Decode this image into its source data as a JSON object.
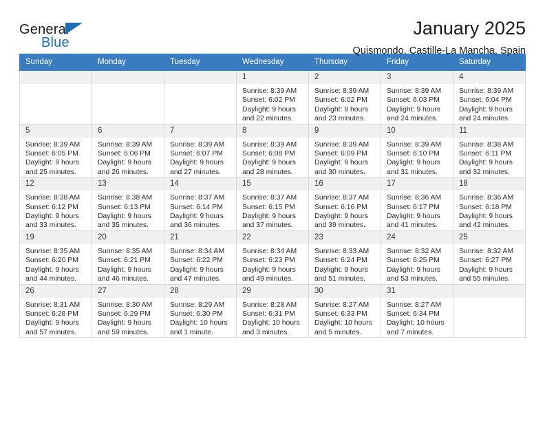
{
  "brand": {
    "word_general": "General",
    "word_blue": "Blue",
    "flag_icon": "brand-flag-icon"
  },
  "header": {
    "title": "January 2025",
    "subtitle": "Quismondo, Castille-La Mancha, Spain"
  },
  "theme": {
    "header_bg": "#3a7cc0",
    "header_text": "#ffffff",
    "daynum_bg": "#f0f0f0",
    "grid_border": "#d9d9d9",
    "brand_blue": "#1d6fb8"
  },
  "calendar": {
    "weekday_headers": [
      "Sunday",
      "Monday",
      "Tuesday",
      "Wednesday",
      "Thursday",
      "Friday",
      "Saturday"
    ],
    "weeks": [
      [
        {
          "day": "",
          "lines": []
        },
        {
          "day": "",
          "lines": []
        },
        {
          "day": "",
          "lines": []
        },
        {
          "day": "1",
          "lines": [
            "Sunrise: 8:39 AM",
            "Sunset: 6:02 PM",
            "Daylight: 9 hours",
            "and 22 minutes."
          ]
        },
        {
          "day": "2",
          "lines": [
            "Sunrise: 8:39 AM",
            "Sunset: 6:02 PM",
            "Daylight: 9 hours",
            "and 23 minutes."
          ]
        },
        {
          "day": "3",
          "lines": [
            "Sunrise: 8:39 AM",
            "Sunset: 6:03 PM",
            "Daylight: 9 hours",
            "and 24 minutes."
          ]
        },
        {
          "day": "4",
          "lines": [
            "Sunrise: 8:39 AM",
            "Sunset: 6:04 PM",
            "Daylight: 9 hours",
            "and 24 minutes."
          ]
        }
      ],
      [
        {
          "day": "5",
          "lines": [
            "Sunrise: 8:39 AM",
            "Sunset: 6:05 PM",
            "Daylight: 9 hours",
            "and 25 minutes."
          ]
        },
        {
          "day": "6",
          "lines": [
            "Sunrise: 8:39 AM",
            "Sunset: 6:06 PM",
            "Daylight: 9 hours",
            "and 26 minutes."
          ]
        },
        {
          "day": "7",
          "lines": [
            "Sunrise: 8:39 AM",
            "Sunset: 6:07 PM",
            "Daylight: 9 hours",
            "and 27 minutes."
          ]
        },
        {
          "day": "8",
          "lines": [
            "Sunrise: 8:39 AM",
            "Sunset: 6:08 PM",
            "Daylight: 9 hours",
            "and 28 minutes."
          ]
        },
        {
          "day": "9",
          "lines": [
            "Sunrise: 8:39 AM",
            "Sunset: 6:09 PM",
            "Daylight: 9 hours",
            "and 30 minutes."
          ]
        },
        {
          "day": "10",
          "lines": [
            "Sunrise: 8:39 AM",
            "Sunset: 6:10 PM",
            "Daylight: 9 hours",
            "and 31 minutes."
          ]
        },
        {
          "day": "11",
          "lines": [
            "Sunrise: 8:38 AM",
            "Sunset: 6:11 PM",
            "Daylight: 9 hours",
            "and 32 minutes."
          ]
        }
      ],
      [
        {
          "day": "12",
          "lines": [
            "Sunrise: 8:38 AM",
            "Sunset: 6:12 PM",
            "Daylight: 9 hours",
            "and 33 minutes."
          ]
        },
        {
          "day": "13",
          "lines": [
            "Sunrise: 8:38 AM",
            "Sunset: 6:13 PM",
            "Daylight: 9 hours",
            "and 35 minutes."
          ]
        },
        {
          "day": "14",
          "lines": [
            "Sunrise: 8:37 AM",
            "Sunset: 6:14 PM",
            "Daylight: 9 hours",
            "and 36 minutes."
          ]
        },
        {
          "day": "15",
          "lines": [
            "Sunrise: 8:37 AM",
            "Sunset: 6:15 PM",
            "Daylight: 9 hours",
            "and 37 minutes."
          ]
        },
        {
          "day": "16",
          "lines": [
            "Sunrise: 8:37 AM",
            "Sunset: 6:16 PM",
            "Daylight: 9 hours",
            "and 39 minutes."
          ]
        },
        {
          "day": "17",
          "lines": [
            "Sunrise: 8:36 AM",
            "Sunset: 6:17 PM",
            "Daylight: 9 hours",
            "and 41 minutes."
          ]
        },
        {
          "day": "18",
          "lines": [
            "Sunrise: 8:36 AM",
            "Sunset: 6:18 PM",
            "Daylight: 9 hours",
            "and 42 minutes."
          ]
        }
      ],
      [
        {
          "day": "19",
          "lines": [
            "Sunrise: 8:35 AM",
            "Sunset: 6:20 PM",
            "Daylight: 9 hours",
            "and 44 minutes."
          ]
        },
        {
          "day": "20",
          "lines": [
            "Sunrise: 8:35 AM",
            "Sunset: 6:21 PM",
            "Daylight: 9 hours",
            "and 46 minutes."
          ]
        },
        {
          "day": "21",
          "lines": [
            "Sunrise: 8:34 AM",
            "Sunset: 6:22 PM",
            "Daylight: 9 hours",
            "and 47 minutes."
          ]
        },
        {
          "day": "22",
          "lines": [
            "Sunrise: 8:34 AM",
            "Sunset: 6:23 PM",
            "Daylight: 9 hours",
            "and 49 minutes."
          ]
        },
        {
          "day": "23",
          "lines": [
            "Sunrise: 8:33 AM",
            "Sunset: 6:24 PM",
            "Daylight: 9 hours",
            "and 51 minutes."
          ]
        },
        {
          "day": "24",
          "lines": [
            "Sunrise: 8:32 AM",
            "Sunset: 6:25 PM",
            "Daylight: 9 hours",
            "and 53 minutes."
          ]
        },
        {
          "day": "25",
          "lines": [
            "Sunrise: 8:32 AM",
            "Sunset: 6:27 PM",
            "Daylight: 9 hours",
            "and 55 minutes."
          ]
        }
      ],
      [
        {
          "day": "26",
          "lines": [
            "Sunrise: 8:31 AM",
            "Sunset: 6:28 PM",
            "Daylight: 9 hours",
            "and 57 minutes."
          ]
        },
        {
          "day": "27",
          "lines": [
            "Sunrise: 8:30 AM",
            "Sunset: 6:29 PM",
            "Daylight: 9 hours",
            "and 59 minutes."
          ]
        },
        {
          "day": "28",
          "lines": [
            "Sunrise: 8:29 AM",
            "Sunset: 6:30 PM",
            "Daylight: 10 hours",
            "and 1 minute."
          ]
        },
        {
          "day": "29",
          "lines": [
            "Sunrise: 8:28 AM",
            "Sunset: 6:31 PM",
            "Daylight: 10 hours",
            "and 3 minutes."
          ]
        },
        {
          "day": "30",
          "lines": [
            "Sunrise: 8:27 AM",
            "Sunset: 6:33 PM",
            "Daylight: 10 hours",
            "and 5 minutes."
          ]
        },
        {
          "day": "31",
          "lines": [
            "Sunrise: 8:27 AM",
            "Sunset: 6:34 PM",
            "Daylight: 10 hours",
            "and 7 minutes."
          ]
        },
        {
          "day": "",
          "lines": []
        }
      ]
    ]
  }
}
